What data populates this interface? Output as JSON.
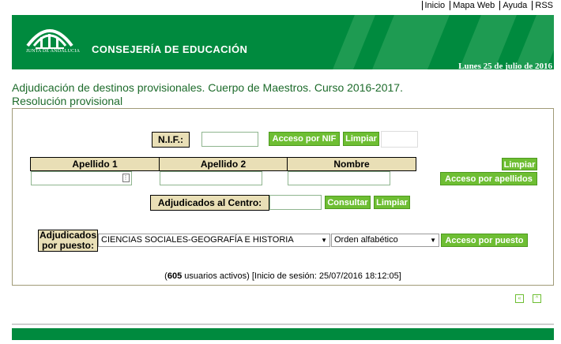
{
  "toplinks": [
    "Inicio",
    "Mapa Web",
    "Ayuda",
    "RSS"
  ],
  "banner": {
    "logo_text": "JUNTA DE ANDALUCIA",
    "consejeria": "CONSEJERÍA DE EDUCACIÓN",
    "date": "Lunes 25 de julio de 2016",
    "colors": {
      "green": "#008a3e",
      "stripe": "#1e9b52"
    }
  },
  "title_line1": "Adjudicación de destinos provisionales. Cuerpo de Maestros. Curso 2016-2017.",
  "title_line2": "Resolución provisional",
  "nif": {
    "label": "N.I.F.:",
    "value": "",
    "acceso_btn": "Acceso por NIF",
    "limpiar_btn": "Limpiar"
  },
  "apellidos": {
    "headers": [
      "Apellido 1",
      "Apellido 2",
      "Nombre"
    ],
    "limpiar_btn": "Limpiar",
    "acceso_btn": "Acceso por apellidos"
  },
  "centro": {
    "label": "Adjudicados al Centro:",
    "consultar_btn": "Consultar",
    "limpiar_btn": "Limpiar"
  },
  "puesto": {
    "label_line1": "Adjudicados",
    "label_line2": "por puesto:",
    "selected_puesto": "CIENCIAS SOCIALES-GEOGRAFÍA E HISTORIA",
    "selected_orden": "Orden alfabético",
    "acceso_btn": "Acceso por puesto"
  },
  "status": {
    "count": "605",
    "usuarios": " usuarios activos) ",
    "sesion": "[Inicio de sesión: 25/07/2016 18:12:05]"
  },
  "accent_colors": {
    "button": "#6ebe33",
    "label_bg": "#e9dfb6",
    "title": "#1d6b2b"
  }
}
